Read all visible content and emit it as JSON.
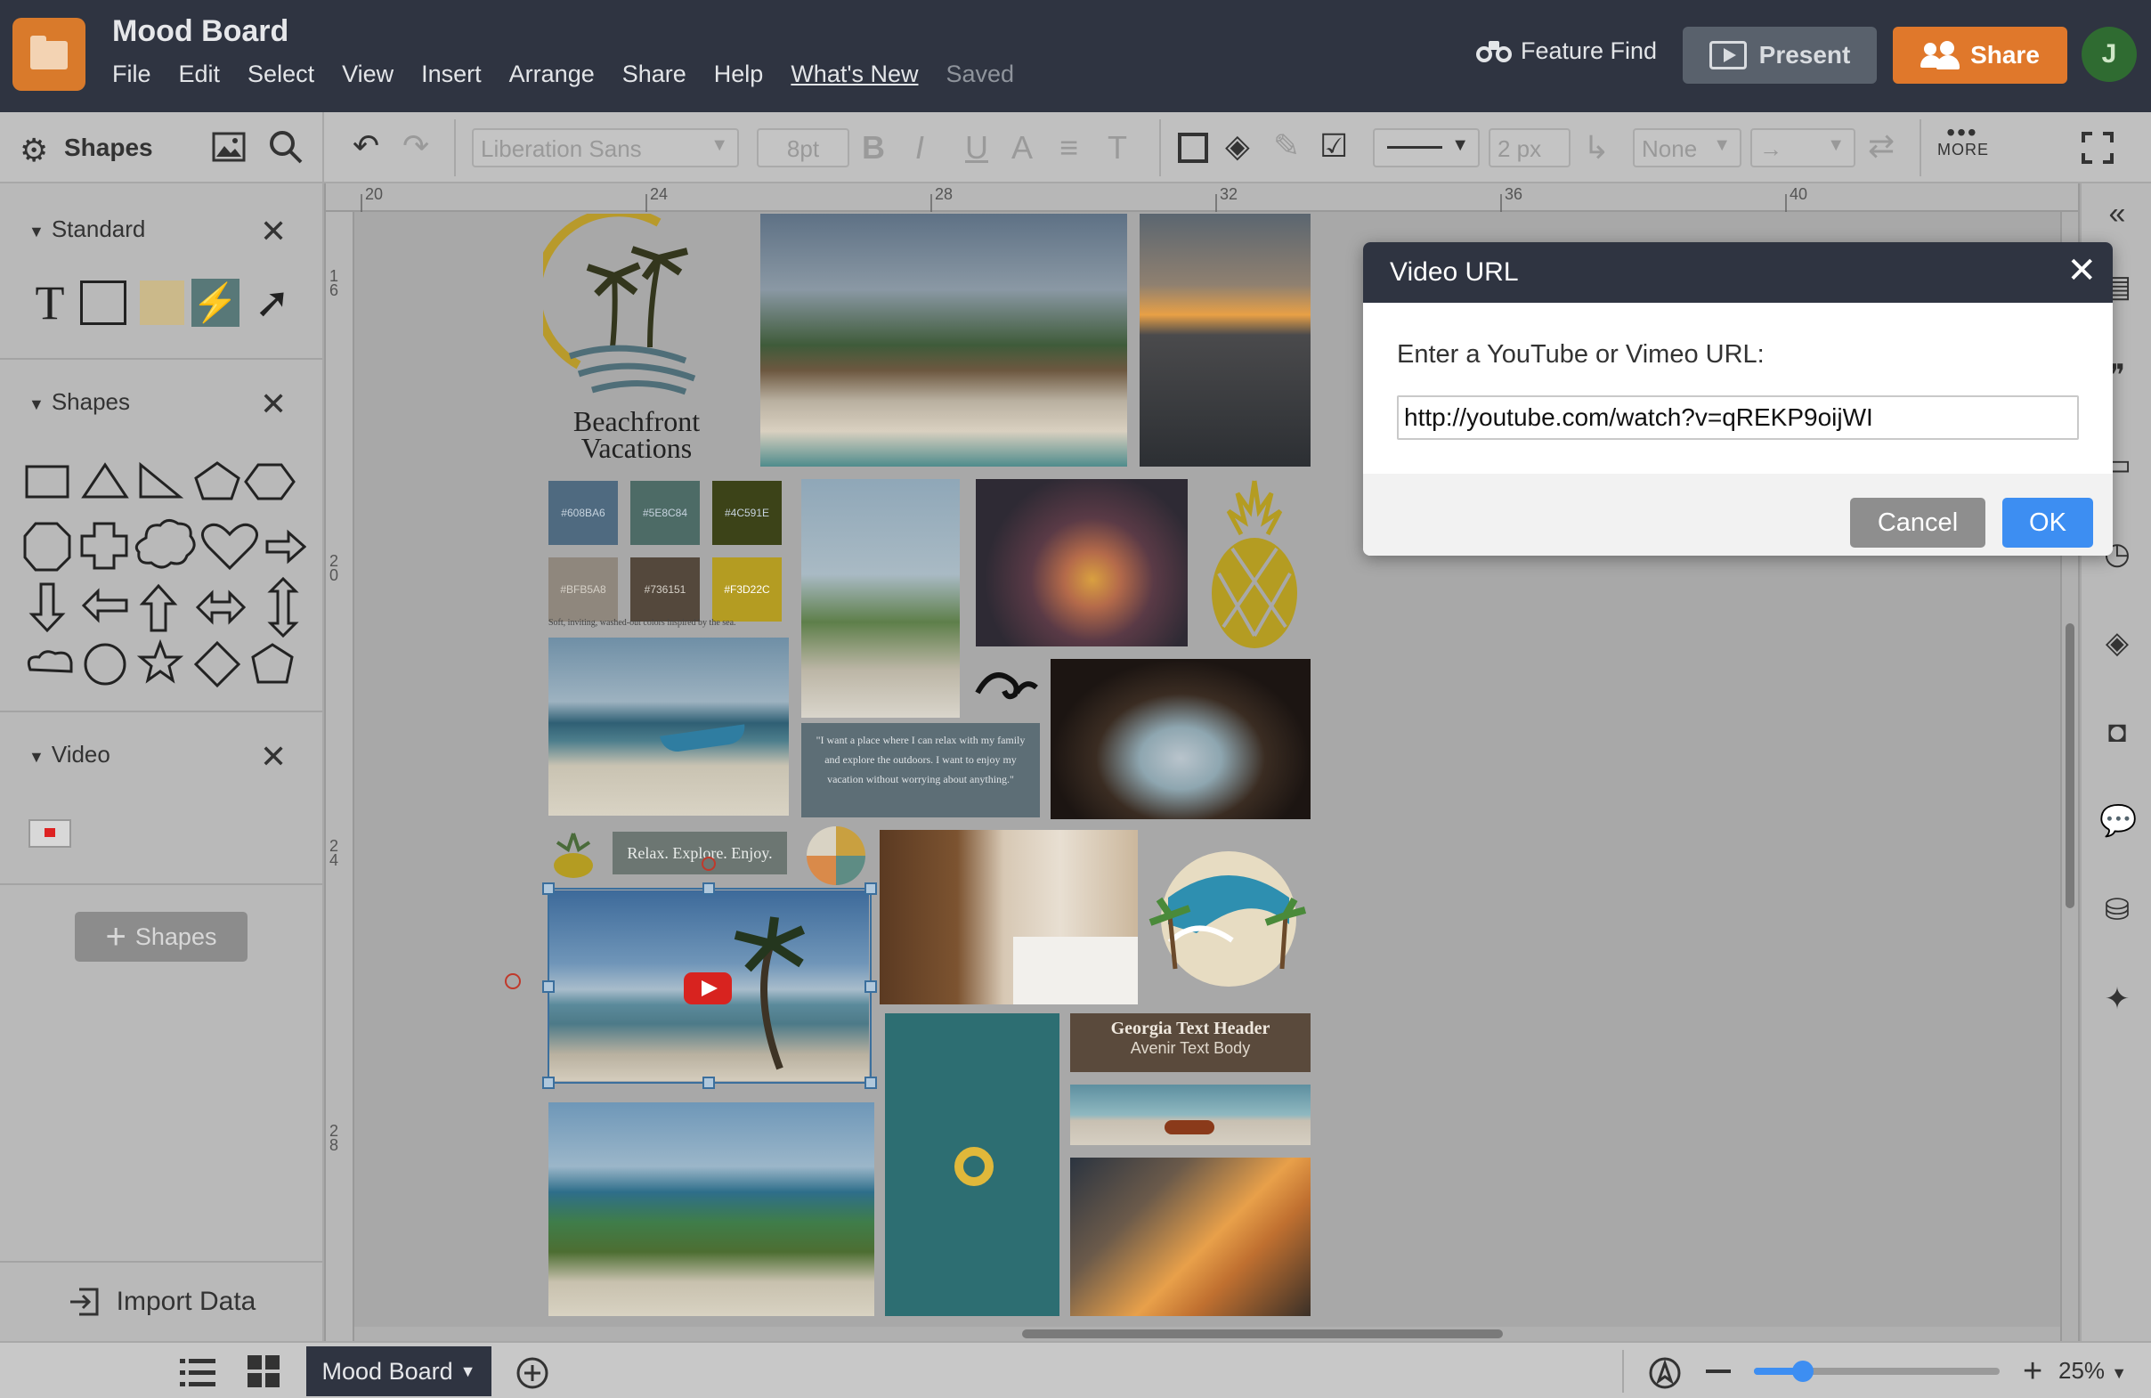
{
  "app": {
    "doc_title": "Mood Board",
    "menu": [
      "File",
      "Edit",
      "Select",
      "View",
      "Insert",
      "Arrange",
      "Share",
      "Help",
      "What's New",
      "Saved"
    ],
    "feature_find": "Feature Find",
    "present": "Present",
    "share": "Share",
    "avatar_initial": "J"
  },
  "toolbar": {
    "shapes_tab": "Shapes",
    "font": "Liberation Sans",
    "font_size": "8pt",
    "line_width": "2 px",
    "arrow_style": "None",
    "more": "MORE",
    "icons": [
      "image-icon",
      "search-icon",
      "undo-icon",
      "redo-icon",
      "bold-icon",
      "italic-icon",
      "underline-icon",
      "text-color-icon",
      "align-icon",
      "text-options-icon",
      "shape-border-icon",
      "fill-icon",
      "line-color-icon",
      "shape-style-icon",
      "swap-icon",
      "fullscreen-icon"
    ]
  },
  "left_panel": {
    "sections": [
      {
        "name": "Standard"
      },
      {
        "name": "Shapes"
      },
      {
        "name": "Video"
      }
    ],
    "add_shapes": "Shapes",
    "import_data": "Import Data"
  },
  "rulers": {
    "top": [
      "20",
      "24",
      "28",
      "32",
      "36",
      "40"
    ],
    "left": [
      "16",
      "20",
      "24",
      "28"
    ]
  },
  "board": {
    "logo_line1": "Beachfront",
    "logo_line2": "Vacations",
    "swatches": [
      "#608BA6",
      "#5E8C84",
      "#4C591E",
      "#BFB5A8",
      "#736151",
      "#F3D22C"
    ],
    "swatch_caption": "Soft, inviting, washed-out colors inspired by the sea.",
    "quote": "\"I want a place where I can relax with my family and explore the outdoors. I want to enjoy my vacation without worrying about anything.\"",
    "banner": "Relax. Explore. Enjoy.",
    "text_header": "Georgia Text Header",
    "text_body": "Avenir Text Body"
  },
  "modal": {
    "title": "Video URL",
    "prompt": "Enter a YouTube or Vimeo URL:",
    "url": "http://youtube.com/watch?v=qREKP9oijWI",
    "cancel": "Cancel",
    "ok": "OK"
  },
  "bottom": {
    "page_tab": "Mood Board",
    "zoom": "25%",
    "zoom_level": 0.2
  },
  "colors": {
    "titlebar": "#2f3441",
    "accent_orange": "#e0782b",
    "ok_blue": "#3d8ef2"
  }
}
